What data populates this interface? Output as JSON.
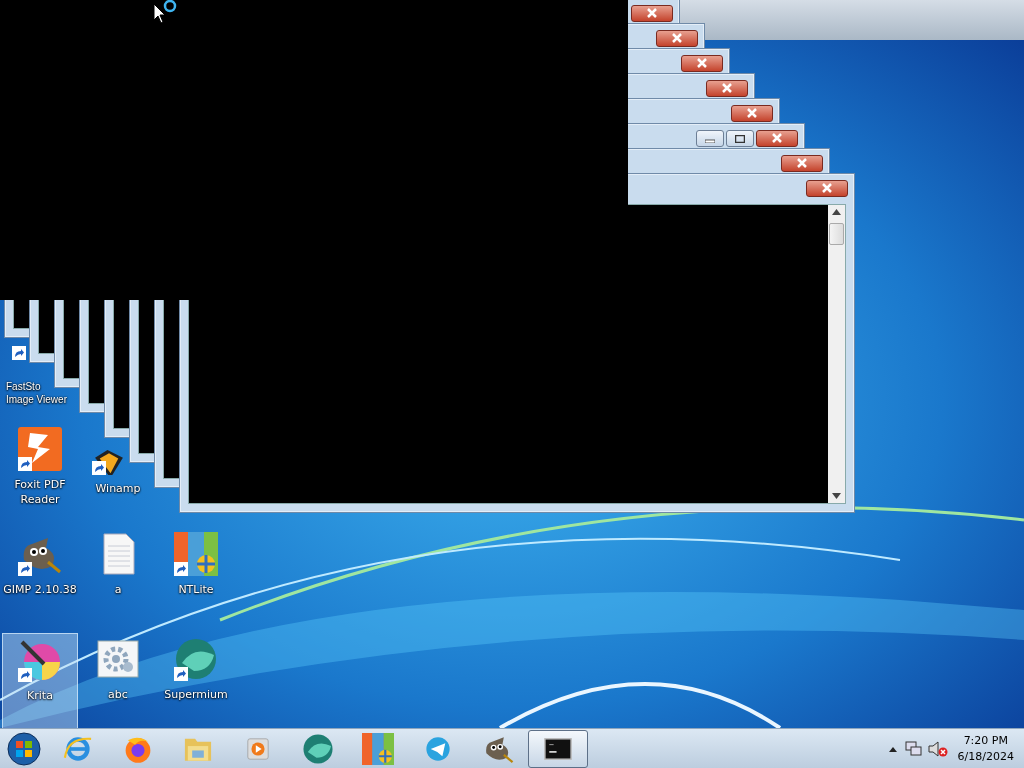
{
  "desktop": {
    "icons": [
      {
        "kind": "faststone",
        "label": "FastSto Image Viewer",
        "shortcut": true,
        "selected": false
      },
      {
        "kind": "foxit",
        "label": "Foxit PDF Reader",
        "shortcut": true,
        "selected": false
      },
      {
        "kind": "winamp",
        "label": "Winamp",
        "shortcut": true,
        "selected": false
      },
      {
        "kind": "gimp",
        "label": "GIMP 2.10.38",
        "shortcut": true,
        "selected": false
      },
      {
        "kind": "document",
        "label": "a",
        "shortcut": false,
        "selected": false
      },
      {
        "kind": "ntlite",
        "label": "NTLite",
        "shortcut": true,
        "selected": false
      },
      {
        "kind": "krita",
        "label": "Krita",
        "shortcut": true,
        "selected": true
      },
      {
        "kind": "settings",
        "label": "abc",
        "shortcut": false,
        "selected": false
      },
      {
        "kind": "supermium",
        "label": "Supermium",
        "shortcut": true,
        "selected": false
      }
    ]
  },
  "windows": [
    {
      "kind": "console",
      "controls": [
        {
          "kind": "close"
        }
      ]
    },
    {
      "kind": "console",
      "controls": [
        {
          "kind": "close"
        }
      ]
    },
    {
      "kind": "console",
      "controls": [
        {
          "kind": "close"
        }
      ]
    },
    {
      "kind": "console",
      "controls": [
        {
          "kind": "close"
        }
      ]
    },
    {
      "kind": "console",
      "controls": [
        {
          "kind": "close"
        }
      ]
    },
    {
      "kind": "console",
      "controls": [
        {
          "kind": "minimize"
        },
        {
          "kind": "maximize"
        },
        {
          "kind": "close"
        }
      ]
    },
    {
      "kind": "console",
      "controls": [
        {
          "kind": "close"
        }
      ]
    },
    {
      "kind": "console",
      "controls": [
        {
          "kind": "close"
        }
      ]
    }
  ],
  "taskbar": {
    "items": [
      {
        "kind": "ie",
        "selected": false
      },
      {
        "kind": "firefox",
        "selected": false
      },
      {
        "kind": "explorer",
        "selected": false
      },
      {
        "kind": "media",
        "selected": false
      },
      {
        "kind": "supermium",
        "selected": false
      },
      {
        "kind": "ntlite",
        "selected": false
      },
      {
        "kind": "telegram",
        "selected": false
      },
      {
        "kind": "gimp",
        "selected": false
      },
      {
        "kind": "console",
        "selected": true
      }
    ],
    "clock": {
      "time": "7:20 PM",
      "date": "6/18/2024"
    },
    "volume_muted": true
  }
}
